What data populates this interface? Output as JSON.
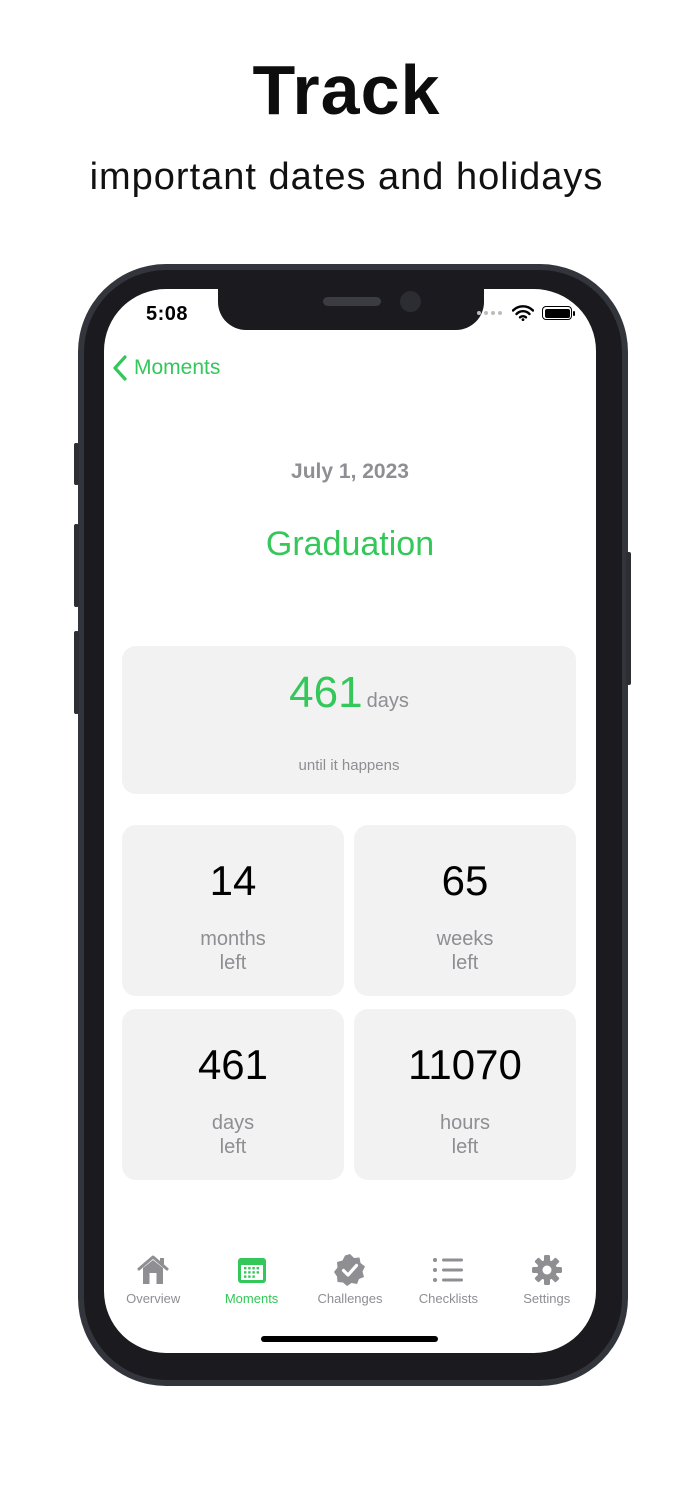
{
  "promo": {
    "headline": "Track",
    "subheadline": "important dates and holidays"
  },
  "status_bar": {
    "time": "5:08"
  },
  "nav": {
    "back_label": "Moments"
  },
  "moment": {
    "date": "July 1, 2023",
    "title": "Graduation"
  },
  "countdown": {
    "value": "461",
    "unit": "days",
    "caption": "until it happens"
  },
  "stats": [
    {
      "value": "14",
      "unit": "months",
      "suffix": "left"
    },
    {
      "value": "65",
      "unit": "weeks",
      "suffix": "left"
    },
    {
      "value": "461",
      "unit": "days",
      "suffix": "left"
    },
    {
      "value": "11070",
      "unit": "hours",
      "suffix": "left"
    }
  ],
  "tabs": [
    {
      "label": "Overview",
      "icon": "house-icon",
      "active": false
    },
    {
      "label": "Moments",
      "icon": "calendar-icon",
      "active": true
    },
    {
      "label": "Challenges",
      "icon": "badge-check-icon",
      "active": false
    },
    {
      "label": "Checklists",
      "icon": "list-icon",
      "active": false
    },
    {
      "label": "Settings",
      "icon": "gear-icon",
      "active": false
    }
  ],
  "colors": {
    "accent": "#34c759",
    "secondary_text": "#8e8e93",
    "card_background": "#f2f2f2",
    "phone_frame": "#33353c"
  }
}
